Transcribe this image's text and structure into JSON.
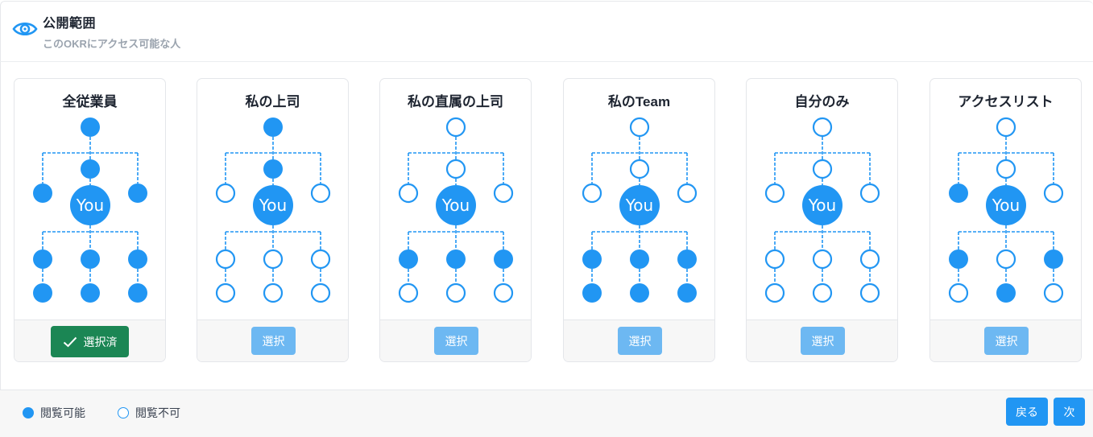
{
  "header": {
    "icon": "eye-icon",
    "title": "公開範囲",
    "subtitle": "このOKRにアクセス可能な人"
  },
  "colors": {
    "accent": "#2196f3",
    "selected": "#1b8654",
    "select_button": "#6db8f2",
    "footer_bg": "#f7f7f7"
  },
  "you_label": "You",
  "cards": [
    {
      "title": "全従業員",
      "selected": true,
      "button_label": "選択済",
      "nodes": {
        "top": true,
        "boss": true,
        "peer_left": true,
        "peer_right": true,
        "reports": [
          true,
          true,
          true
        ],
        "sub_reports": [
          true,
          true,
          true
        ]
      }
    },
    {
      "title": "私の上司",
      "selected": false,
      "button_label": "選択",
      "nodes": {
        "top": true,
        "boss": true,
        "peer_left": false,
        "peer_right": false,
        "reports": [
          false,
          false,
          false
        ],
        "sub_reports": [
          false,
          false,
          false
        ]
      }
    },
    {
      "title": "私の直属の上司",
      "selected": false,
      "button_label": "選択",
      "nodes": {
        "top": false,
        "boss": false,
        "peer_left": false,
        "peer_right": false,
        "reports": [
          true,
          true,
          true
        ],
        "sub_reports": [
          false,
          false,
          false
        ]
      }
    },
    {
      "title": "私のTeam",
      "selected": false,
      "button_label": "選択",
      "nodes": {
        "top": false,
        "boss": false,
        "peer_left": false,
        "peer_right": false,
        "reports": [
          true,
          true,
          true
        ],
        "sub_reports": [
          true,
          true,
          true
        ]
      }
    },
    {
      "title": "自分のみ",
      "selected": false,
      "button_label": "選択",
      "nodes": {
        "top": false,
        "boss": false,
        "peer_left": false,
        "peer_right": false,
        "reports": [
          false,
          false,
          false
        ],
        "sub_reports": [
          false,
          false,
          false
        ]
      }
    },
    {
      "title": "アクセスリスト",
      "selected": false,
      "button_label": "選択",
      "nodes": {
        "top": false,
        "boss": false,
        "peer_left": true,
        "peer_right": false,
        "reports": [
          true,
          false,
          true
        ],
        "sub_reports": [
          false,
          true,
          false
        ]
      }
    }
  ],
  "legend": {
    "viewable": "閲覧可能",
    "not_viewable": "閲覧不可"
  },
  "footer": {
    "back_label": "戻る",
    "next_label": "次"
  }
}
